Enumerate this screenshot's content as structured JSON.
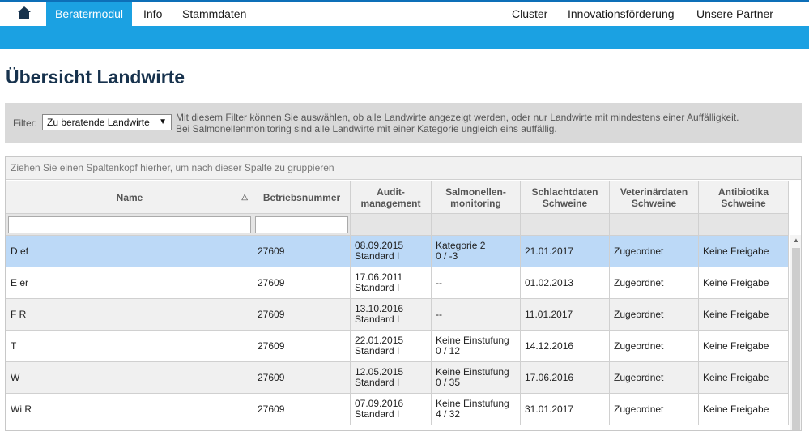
{
  "nav": {
    "items": [
      {
        "label": "Beratermodul",
        "active": true
      },
      {
        "label": "Info"
      },
      {
        "label": "Stammdaten"
      }
    ],
    "right_items": [
      {
        "label": "Cluster"
      },
      {
        "label": "Innovationsförderung"
      },
      {
        "label": "Unsere Partner"
      }
    ],
    "home_icon": "home-icon"
  },
  "page_title": "Übersicht Landwirte",
  "filter": {
    "label": "Filter:",
    "selected": "Zu beratende Landwirte",
    "note_line1": "Mit diesem Filter können Sie auswählen, ob alle Landwirte angezeigt werden, oder nur Landwirte mit mindestens einer Auffälligkeit.",
    "note_line2": "Bei Salmonellenmonitoring sind alle Landwirte mit einer Kategorie ungleich eins auffällig."
  },
  "grid": {
    "group_hint": "Ziehen Sie einen Spaltenkopf hierher, um nach dieser Spalte zu gruppieren",
    "columns": [
      {
        "line1": "Name",
        "line2": ""
      },
      {
        "line1": "Betriebsnummer",
        "line2": ""
      },
      {
        "line1": "Audit-",
        "line2": "management"
      },
      {
        "line1": "Salmonellen-",
        "line2": "monitoring"
      },
      {
        "line1": "Schlachtdaten",
        "line2": "Schweine"
      },
      {
        "line1": "Veterinärdaten",
        "line2": "Schweine"
      },
      {
        "line1": "Antibiotika",
        "line2": "Schweine"
      }
    ],
    "sort_indicator": "△",
    "rows": [
      {
        "name": "D        ef",
        "betrieb": "27609",
        "audit_date": "08.09.2015",
        "audit_std": "Standard I",
        "salm1": "Kategorie 2",
        "salm2": "0 / -3",
        "salm_alert": true,
        "schlacht": "21.01.2017",
        "vet": "Zugeordnet",
        "anti": "Keine Freigabe"
      },
      {
        "name": "E              er",
        "betrieb": "27609",
        "audit_date": "17.06.2011",
        "audit_std": "Standard I",
        "salm1": "--",
        "salm2": "",
        "salm_alert": false,
        "schlacht": "01.02.2013",
        "vet": "Zugeordnet",
        "anti": "Keine Freigabe"
      },
      {
        "name": "F                          R",
        "betrieb": "27609",
        "audit_date": "13.10.2016",
        "audit_std": "Standard I",
        "salm1": "--",
        "salm2": "",
        "salm_alert": false,
        "schlacht": "11.01.2017",
        "vet": "Zugeordnet",
        "anti": "Keine Freigabe"
      },
      {
        "name": "T",
        "betrieb": "27609",
        "audit_date": "22.01.2015",
        "audit_std": "Standard I",
        "salm1": "Keine Einstufung",
        "salm2": "0 / 12",
        "salm_alert": true,
        "schlacht": "14.12.2016",
        "vet": "Zugeordnet",
        "anti": "Keine Freigabe"
      },
      {
        "name": "W",
        "betrieb": "27609",
        "audit_date": "12.05.2015",
        "audit_std": "Standard I",
        "salm1": "Keine Einstufung",
        "salm2": "0 / 35",
        "salm_alert": true,
        "schlacht": "17.06.2016",
        "vet": "Zugeordnet",
        "anti": "Keine Freigabe"
      },
      {
        "name": "Wi        R",
        "betrieb": "27609",
        "audit_date": "07.09.2016",
        "audit_std": "Standard I",
        "salm1": "Keine Einstufung",
        "salm2": "4 / 32",
        "salm_alert": true,
        "schlacht": "31.01.2017",
        "vet": "Zugeordnet",
        "anti": "Keine Freigabe"
      }
    ]
  }
}
